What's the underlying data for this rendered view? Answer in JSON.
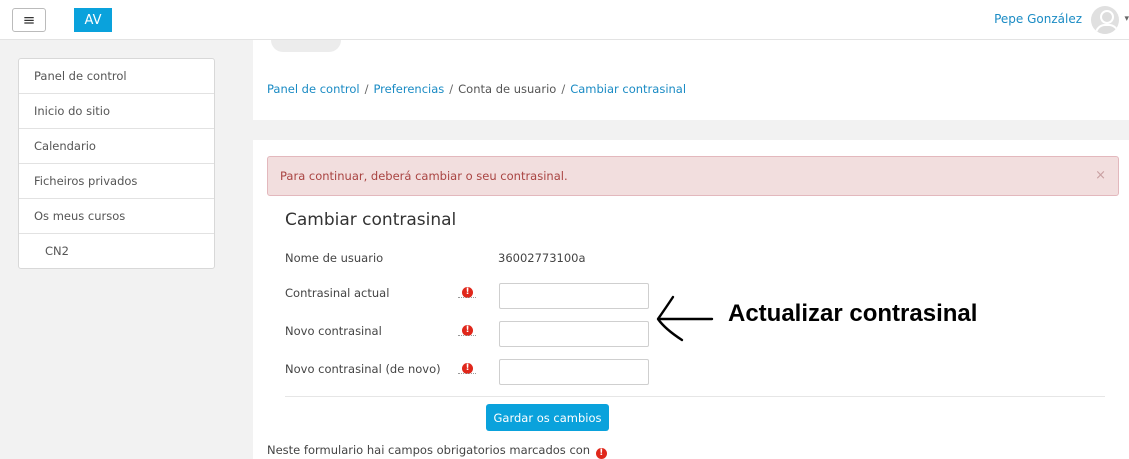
{
  "header": {
    "menu_icon": "hamburger-icon",
    "logo_text": "AV",
    "user_name": "Pepe González",
    "avatar_icon": "user-avatar-icon"
  },
  "sidebar": {
    "items": [
      {
        "label": "Panel de control"
      },
      {
        "label": "Inicio do sitio"
      },
      {
        "label": "Calendario"
      },
      {
        "label": "Ficheiros privados"
      },
      {
        "label": "Os meus cursos"
      },
      {
        "label": "CN2"
      }
    ]
  },
  "breadcrumb": {
    "items": [
      {
        "label": "Panel de control",
        "link": true
      },
      {
        "label": "Preferencias",
        "link": true
      },
      {
        "label": "Conta de usuario",
        "link": false
      },
      {
        "label": "Cambiar contrasinal",
        "link": true
      }
    ],
    "separator": "/"
  },
  "alert": {
    "message": "Para continuar, deberá cambiar o seu contrasinal.",
    "close": "×"
  },
  "form": {
    "title": "Cambiar contrasinal",
    "username_label": "Nome de usuario",
    "username_value": "36002773100a",
    "current_password_label": "Contrasinal actual",
    "new_password_label": "Novo contrasinal",
    "new_password_again_label": "Novo contrasinal (de novo)",
    "required_icon": "required-exclamation-icon",
    "required_glyph": "!",
    "save_label": "Gardar os cambios",
    "footnote": "Neste formulario hai campos obrigatorios marcados con"
  },
  "annotation": {
    "text": "Actualizar contrasinal"
  },
  "colors": {
    "accent": "#0aa2dc",
    "link": "#1a8bc4",
    "alert_bg": "#f2dede",
    "alert_text": "#a94442",
    "required": "#e0271b"
  }
}
